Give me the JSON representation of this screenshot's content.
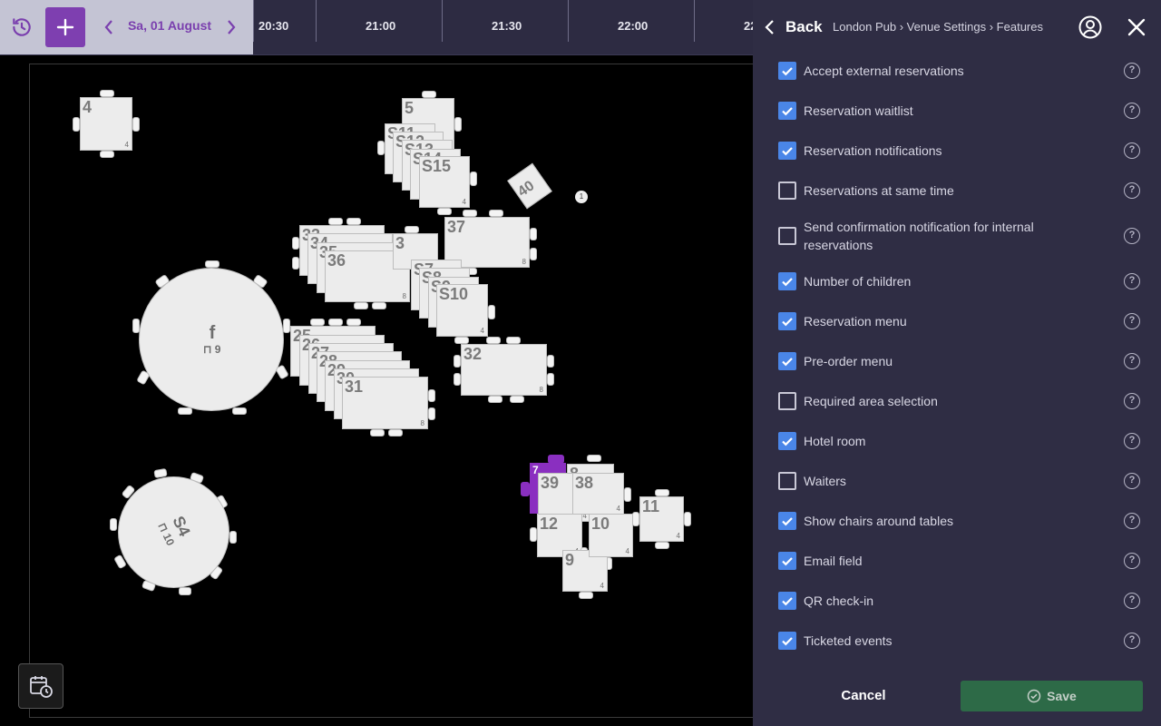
{
  "toolbar": {
    "date": "Sa, 01 August",
    "times": [
      "20:30",
      "21:00",
      "21:30",
      "22:00",
      "22:"
    ]
  },
  "floor_plan": {
    "tables": [
      {
        "id": "4",
        "capacity": "4"
      },
      {
        "id": "5",
        "capacity": ""
      },
      {
        "id": "S11",
        "capacity": ""
      },
      {
        "id": "S12",
        "capacity": ""
      },
      {
        "id": "S13",
        "capacity": ""
      },
      {
        "id": "S14",
        "capacity": ""
      },
      {
        "id": "S15",
        "capacity": "4"
      },
      {
        "id": "40",
        "capacity": ""
      },
      {
        "id": "37",
        "capacity": "8"
      },
      {
        "id": "33",
        "capacity": ""
      },
      {
        "id": "34",
        "capacity": ""
      },
      {
        "id": "35",
        "capacity": ""
      },
      {
        "id": "36",
        "capacity": "8"
      },
      {
        "id": "3",
        "capacity": ""
      },
      {
        "id": "S7",
        "capacity": ""
      },
      {
        "id": "S8",
        "capacity": ""
      },
      {
        "id": "S9",
        "capacity": ""
      },
      {
        "id": "S10",
        "capacity": "4"
      },
      {
        "id": "f",
        "capacity": "9"
      },
      {
        "id": "25",
        "capacity": ""
      },
      {
        "id": "26",
        "capacity": ""
      },
      {
        "id": "27",
        "capacity": ""
      },
      {
        "id": "28",
        "capacity": ""
      },
      {
        "id": "29",
        "capacity": ""
      },
      {
        "id": "30",
        "capacity": ""
      },
      {
        "id": "31",
        "capacity": "8"
      },
      {
        "id": "32",
        "capacity": "8"
      },
      {
        "id": "7",
        "capacity": ""
      },
      {
        "id": "8",
        "capacity": ""
      },
      {
        "id": "39",
        "capacity": "4"
      },
      {
        "id": "38",
        "capacity": "4"
      },
      {
        "id": "11",
        "capacity": "4"
      },
      {
        "id": "12",
        "capacity": "4"
      },
      {
        "id": "10",
        "capacity": "4"
      },
      {
        "id": "9",
        "capacity": "4"
      },
      {
        "id": "S4",
        "capacity": "10"
      }
    ],
    "marker": "1"
  },
  "panel": {
    "back_label": "Back",
    "breadcrumb": "London Pub › Venue Settings › Features",
    "features": [
      {
        "label": "Accept external reservations",
        "checked": true
      },
      {
        "label": "Reservation waitlist",
        "checked": true
      },
      {
        "label": "Reservation notifications",
        "checked": true
      },
      {
        "label": "Reservations at same time",
        "checked": false
      },
      {
        "label": "Send confirmation notification for internal reservations",
        "checked": false
      },
      {
        "label": "Number of children",
        "checked": true
      },
      {
        "label": "Reservation menu",
        "checked": true
      },
      {
        "label": "Pre-order menu",
        "checked": true
      },
      {
        "label": "Required area selection",
        "checked": false
      },
      {
        "label": "Hotel room",
        "checked": true
      },
      {
        "label": "Waiters",
        "checked": false
      },
      {
        "label": "Show chairs around tables",
        "checked": true
      },
      {
        "label": "Email field",
        "checked": true
      },
      {
        "label": "QR check-in",
        "checked": true
      },
      {
        "label": "Ticketed events",
        "checked": true
      }
    ],
    "help_glyph": "?",
    "cancel_label": "Cancel",
    "save_label": "Save"
  },
  "colors": {
    "panel_bg": "#2f2d44",
    "checkbox_on": "#4a86e8",
    "add_button": "#7e3fb0",
    "save_button": "#2d6a47",
    "selected_table": "#8a2fc0"
  }
}
